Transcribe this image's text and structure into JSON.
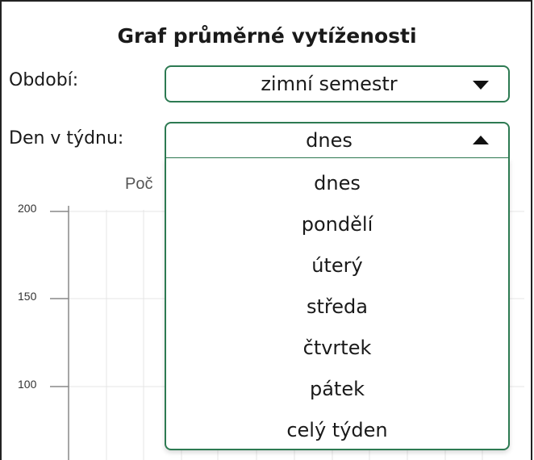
{
  "title": "Graf průměrné vytíženosti",
  "period": {
    "label": "Období:",
    "value": "zimní semestr"
  },
  "weekday": {
    "label": "Den v týdnu:",
    "value": "dnes",
    "options": [
      "dnes",
      "pondělí",
      "úterý",
      "středa",
      "čtvrtek",
      "pátek",
      "celý týden"
    ]
  },
  "chart": {
    "title_fragment": "Poč",
    "yticks": [
      "200",
      "150",
      "100"
    ]
  },
  "colors": {
    "accent": "#2d7a52"
  },
  "icons": {
    "period_arrow": "triangle-down-icon",
    "weekday_arrow": "triangle-up-icon"
  }
}
